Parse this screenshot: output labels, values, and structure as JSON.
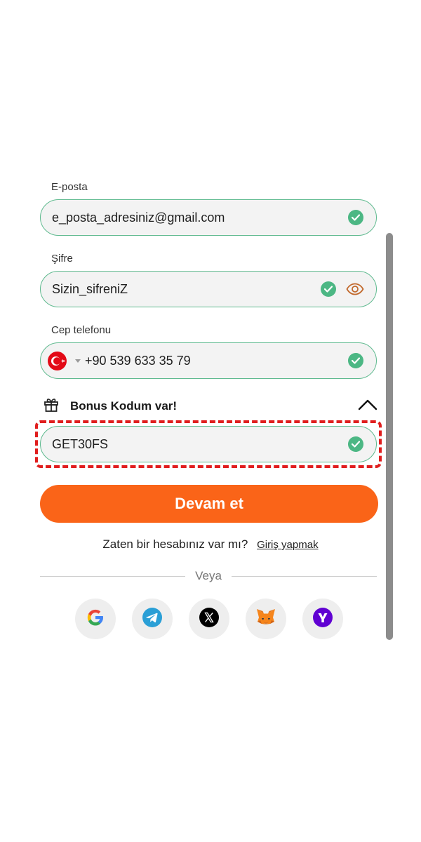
{
  "form": {
    "email": {
      "label": "E-posta",
      "value": "e_posta_adresiniz@gmail.com"
    },
    "password": {
      "label": "Şifre",
      "value": "Sizin_sifreniZ"
    },
    "phone": {
      "label": "Cep telefonu",
      "value": "+90 539 633 35 79",
      "country_flag": "turkey-flag-icon"
    },
    "bonus": {
      "toggle_label": "Bonus Kodum var!",
      "code": "GET30FS",
      "expanded": true
    },
    "submit_label": "Devam et"
  },
  "login": {
    "prompt": "Zaten bir hesabınız var mı?",
    "link": "Giriş yapmak"
  },
  "divider_text": "Veya",
  "social_buttons": [
    "google-icon",
    "telegram-icon",
    "x-icon",
    "metamask-icon",
    "yahoo-icon"
  ],
  "colors": {
    "accent": "#fa6418",
    "valid_border": "#5fba8f",
    "check": "#4cb784",
    "highlight": "#e01e1e",
    "eye_icon": "#c26a2e"
  }
}
